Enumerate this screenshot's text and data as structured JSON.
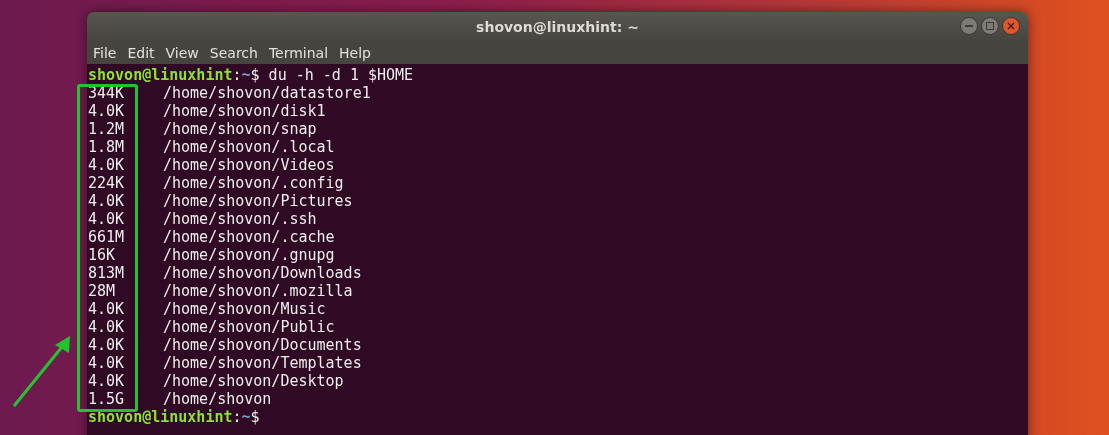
{
  "window": {
    "title": "shovon@linuxhint: ~"
  },
  "menu": [
    "File",
    "Edit",
    "View",
    "Search",
    "Terminal",
    "Help"
  ],
  "terminal": {
    "prompt": {
      "user_host": "shovon@linuxhint",
      "separator": ":",
      "path": "~",
      "command": "$ du -h -d 1 $HOME"
    },
    "output": [
      {
        "size": "344K",
        "path": "/home/shovon/datastore1"
      },
      {
        "size": "4.0K",
        "path": "/home/shovon/disk1"
      },
      {
        "size": "1.2M",
        "path": "/home/shovon/snap"
      },
      {
        "size": "1.8M",
        "path": "/home/shovon/.local"
      },
      {
        "size": "4.0K",
        "path": "/home/shovon/Videos"
      },
      {
        "size": "224K",
        "path": "/home/shovon/.config"
      },
      {
        "size": "4.0K",
        "path": "/home/shovon/Pictures"
      },
      {
        "size": "4.0K",
        "path": "/home/shovon/.ssh"
      },
      {
        "size": "661M",
        "path": "/home/shovon/.cache"
      },
      {
        "size": "16K",
        "path": "/home/shovon/.gnupg"
      },
      {
        "size": "813M",
        "path": "/home/shovon/Downloads"
      },
      {
        "size": "28M",
        "path": "/home/shovon/.mozilla"
      },
      {
        "size": "4.0K",
        "path": "/home/shovon/Music"
      },
      {
        "size": "4.0K",
        "path": "/home/shovon/Public"
      },
      {
        "size": "4.0K",
        "path": "/home/shovon/Documents"
      },
      {
        "size": "4.0K",
        "path": "/home/shovon/Templates"
      },
      {
        "size": "4.0K",
        "path": "/home/shovon/Desktop"
      },
      {
        "size": "1.5G",
        "path": "/home/shovon"
      }
    ],
    "final_prompt": {
      "user_host": "shovon@linuxhint",
      "separator": ":",
      "path": "~",
      "command": "$"
    }
  }
}
